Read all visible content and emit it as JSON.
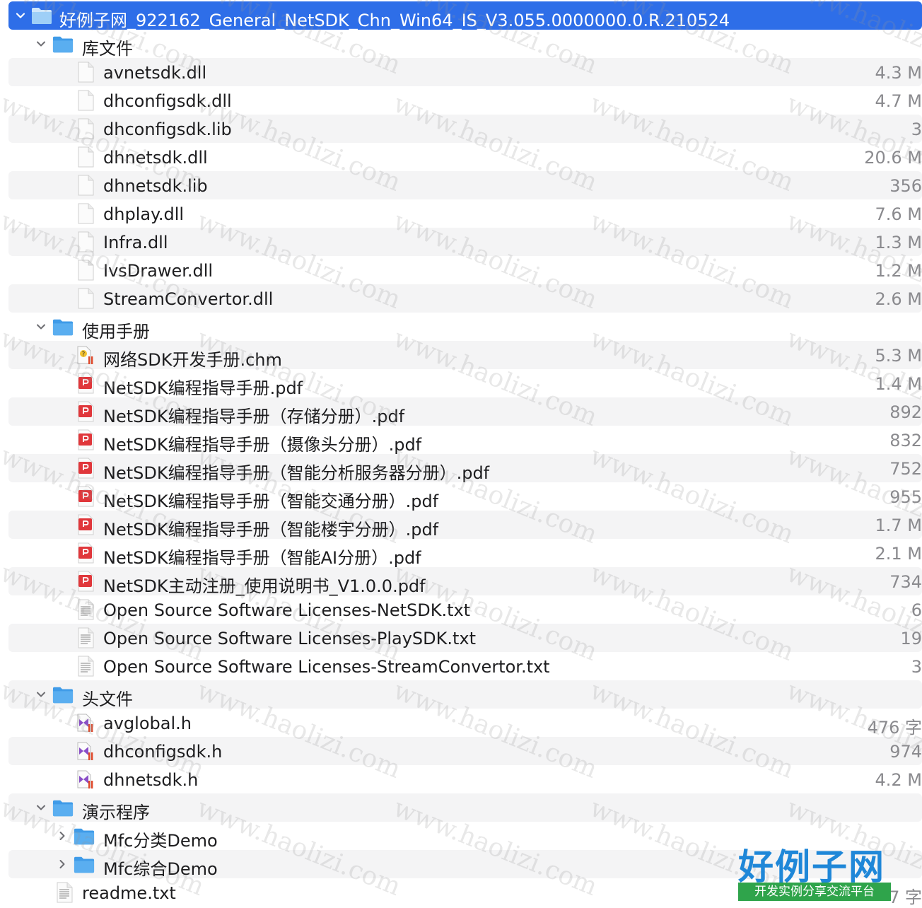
{
  "root": {
    "name": "好例子网_922162_General_NetSDK_Chn_Win64_IS_V3.055.0000000.0.R.210524"
  },
  "rows": [
    {
      "depth": 1,
      "kind": "folder",
      "expanded": true,
      "name": "库文件",
      "size": ""
    },
    {
      "depth": 2,
      "kind": "file",
      "name": "avnetsdk.dll",
      "size": "4.3 M"
    },
    {
      "depth": 2,
      "kind": "file",
      "name": "dhconfigsdk.dll",
      "size": "4.7 M"
    },
    {
      "depth": 2,
      "kind": "file",
      "name": "dhconfigsdk.lib",
      "size": "3"
    },
    {
      "depth": 2,
      "kind": "file",
      "name": "dhnetsdk.dll",
      "size": "20.6 M"
    },
    {
      "depth": 2,
      "kind": "file",
      "name": "dhnetsdk.lib",
      "size": "356"
    },
    {
      "depth": 2,
      "kind": "file",
      "name": "dhplay.dll",
      "size": "7.6 M"
    },
    {
      "depth": 2,
      "kind": "file",
      "name": "Infra.dll",
      "size": "1.3 M"
    },
    {
      "depth": 2,
      "kind": "file",
      "name": "IvsDrawer.dll",
      "size": "1.2 M"
    },
    {
      "depth": 2,
      "kind": "file",
      "name": "StreamConvertor.dll",
      "size": "2.6 M"
    },
    {
      "depth": 1,
      "kind": "folder",
      "expanded": true,
      "name": "使用手册",
      "size": ""
    },
    {
      "depth": 2,
      "kind": "chm",
      "name": "网络SDK开发手册.chm",
      "size": "5.3 M"
    },
    {
      "depth": 2,
      "kind": "pdf",
      "name": "NetSDK编程指导手册.pdf",
      "size": "1.4 M"
    },
    {
      "depth": 2,
      "kind": "pdf",
      "name": "NetSDK编程指导手册（存储分册）.pdf",
      "size": "892"
    },
    {
      "depth": 2,
      "kind": "pdf",
      "name": "NetSDK编程指导手册（摄像头分册）.pdf",
      "size": "832"
    },
    {
      "depth": 2,
      "kind": "pdf",
      "name": "NetSDK编程指导手册（智能分析服务器分册）.pdf",
      "size": "752"
    },
    {
      "depth": 2,
      "kind": "pdf",
      "name": "NetSDK编程指导手册（智能交通分册）.pdf",
      "size": "955"
    },
    {
      "depth": 2,
      "kind": "pdf",
      "name": "NetSDK编程指导手册（智能楼宇分册）.pdf",
      "size": "1.7 M"
    },
    {
      "depth": 2,
      "kind": "pdf",
      "name": "NetSDK编程指导手册（智能AI分册）.pdf",
      "size": "2.1 M"
    },
    {
      "depth": 2,
      "kind": "pdf",
      "name": "NetSDK主动注册_使用说明书_V1.0.0.pdf",
      "size": "734"
    },
    {
      "depth": 2,
      "kind": "txt",
      "name": "Open Source Software Licenses-NetSDK.txt",
      "size": "6"
    },
    {
      "depth": 2,
      "kind": "txt",
      "name": "Open Source Software Licenses-PlaySDK.txt",
      "size": "19"
    },
    {
      "depth": 2,
      "kind": "txt",
      "name": "Open Source Software Licenses-StreamConvertor.txt",
      "size": "3"
    },
    {
      "depth": 1,
      "kind": "folder",
      "expanded": true,
      "name": "头文件",
      "size": ""
    },
    {
      "depth": 2,
      "kind": "h",
      "name": "avglobal.h",
      "size": "476 字"
    },
    {
      "depth": 2,
      "kind": "h",
      "name": "dhconfigsdk.h",
      "size": "974"
    },
    {
      "depth": 2,
      "kind": "h",
      "name": "dhnetsdk.h",
      "size": "4.2 M"
    },
    {
      "depth": 1,
      "kind": "folder",
      "expanded": true,
      "name": "演示程序",
      "size": ""
    },
    {
      "depth": 2,
      "kind": "folder",
      "expanded": false,
      "name": "Mfc分类Demo",
      "size": ""
    },
    {
      "depth": 2,
      "kind": "folder",
      "expanded": false,
      "name": "Mfc综合Demo",
      "size": ""
    },
    {
      "depth": 1,
      "kind": "txt",
      "name": "readme.txt",
      "size": "7 字"
    }
  ],
  "watermark": {
    "text": "www.haolizi.com"
  },
  "logo": {
    "title": "好例子网",
    "tagline": "开发实例分享交流平台"
  },
  "colors": {
    "selection": "#2e6ee8",
    "folder": "#5aaef0",
    "pdf": "#e0373b",
    "vs": "#8a4fc7"
  }
}
